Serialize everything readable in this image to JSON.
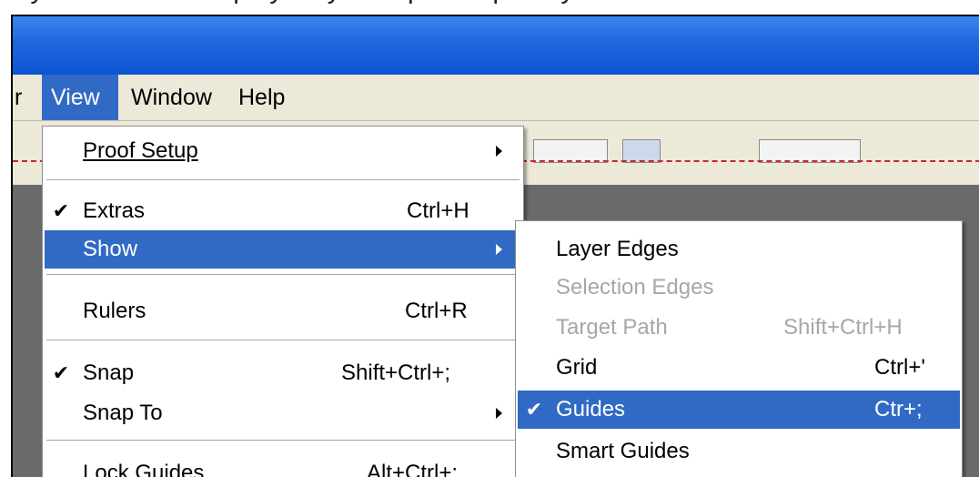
{
  "caption": "ndy. If the Grids display only the specific parts you want to use.",
  "menubar": {
    "partial_left": "r",
    "items": [
      "View",
      "Window",
      "Help"
    ],
    "active": "View"
  },
  "view_menu": {
    "items": [
      {
        "label": "Proof Setup",
        "shortcut": "",
        "submenu": true,
        "checked": false
      },
      {
        "label": "Extras",
        "shortcut": "Ctrl+H",
        "submenu": false,
        "checked": true
      },
      {
        "label": "Show",
        "shortcut": "",
        "submenu": true,
        "checked": false,
        "highlighted": true
      },
      {
        "label": "Rulers",
        "shortcut": "Ctrl+R",
        "submenu": false,
        "checked": false
      },
      {
        "label": "Snap",
        "shortcut": "Shift+Ctrl+;",
        "submenu": false,
        "checked": true
      },
      {
        "label": "Snap To",
        "shortcut": "",
        "submenu": true,
        "checked": false
      },
      {
        "label": "Lock Guides",
        "shortcut": "Alt+Ctrl+;",
        "submenu": false,
        "checked": false
      }
    ]
  },
  "show_submenu": {
    "items": [
      {
        "label": "Layer Edges",
        "shortcut": "",
        "checked": false,
        "disabled": false
      },
      {
        "label": "Selection Edges",
        "shortcut": "",
        "checked": false,
        "disabled": true
      },
      {
        "label": "Target Path",
        "shortcut": "Shift+Ctrl+H",
        "checked": false,
        "disabled": true
      },
      {
        "label": "Grid",
        "shortcut": "Ctrl+'",
        "checked": false,
        "disabled": false
      },
      {
        "label": "Guides",
        "shortcut": "Ctr+;",
        "checked": true,
        "disabled": false,
        "highlighted": true
      },
      {
        "label": "Smart Guides",
        "shortcut": "",
        "checked": false,
        "disabled": false
      }
    ]
  },
  "icons": {
    "check": "✔"
  },
  "colors": {
    "highlight": "#316ac5",
    "titlebar": "#1f66e0",
    "guide": "#c8262c"
  }
}
